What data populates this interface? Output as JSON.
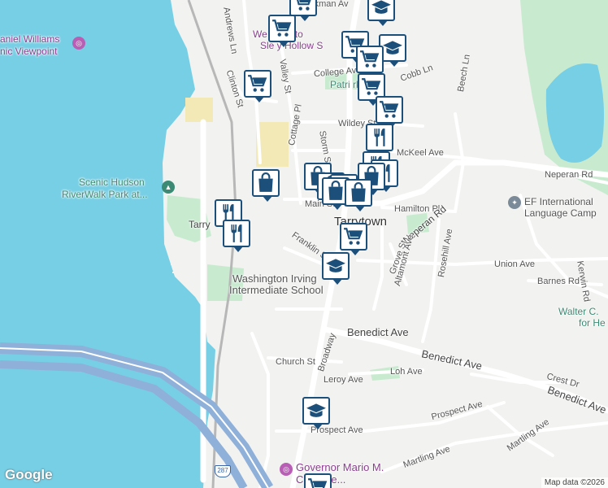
{
  "map": {
    "colors": {
      "water": "#77cfe5",
      "land": "#f2f2f0",
      "park": "#c8ebd0",
      "road": "#ffffff",
      "highway": "#8fb0d9",
      "pin_border": "#1c4f7a",
      "rail": "#b0b0b0"
    },
    "labels": {
      "beekman": "Beekman Av",
      "andrews": "Andrews Ln",
      "daniel_williams": "aniel Williams",
      "scenic_viewpoint": "nic Viewpoint",
      "welcome_historic": "We         to Histo",
      "sleepy_hollow": "Sle   y Hollow S",
      "college_ave": "College Av",
      "valley_st": "Valley St",
      "clinton_st": "Clinton St",
      "cobb_ln": "Cobb Ln",
      "patriot_park": "Patri        rk",
      "beech_ln": "Beech Ln",
      "wildey_st": "Wildey St",
      "storm_st": "Storm St",
      "mckeel_ave": "McKeel Ave",
      "neperan_rd_east": "Neperan Rd",
      "scenic_hudson": "Scenic Hudson",
      "riverwalk": "RiverWalk Park at...",
      "cottage_pl": "Cottage Pl",
      "tarry_partial": "Tarry",
      "ef_international": "EF International",
      "language_camp": "Language Camp",
      "main_st": "Main St",
      "hamilton_pl": "Hamilton Pl",
      "tarrytown": "Tarrytown",
      "neperan_rd": "Neperan Rd",
      "rosehill_ave": "Rosehill Ave",
      "franklin_st": "Franklin St",
      "grove_st": "Grove St",
      "altamont_ave": "Altamont Ave",
      "union_ave": "Union Ave",
      "kerwin_rd": "Kerwin Rd",
      "washington_irving": "Washington Irving",
      "intermediate_school": "Intermediate School",
      "barnes_rd": "Barnes Rd",
      "walter_c": "Walter C.",
      "for_he": "for He",
      "broadway": "Broadway",
      "benedict_ave_1": "Benedict Ave",
      "benedict_ave_2": "Benedict Ave",
      "benedict_ave_3": "Benedict Ave",
      "church_st": "Church St",
      "leroy_ave": "Leroy Ave",
      "loh_ave": "Loh Ave",
      "crest_dr": "Crest Dr",
      "prospect_ave": "Prospect Ave",
      "prospect_ave_2": "Prospect Ave",
      "martling_ave": "Martling Ave",
      "martling_ave_2": "Martling Ave",
      "governor_mario": "Governor Mario M.",
      "bridge": "C         Bridge...",
      "route_287": "287"
    },
    "pins": [
      {
        "name": "grocery-pin",
        "icon": "cart"
      },
      {
        "name": "school-pin",
        "icon": "school"
      },
      {
        "name": "grocery-pin",
        "icon": "cart"
      },
      {
        "name": "grocery-pin",
        "icon": "cart"
      },
      {
        "name": "school-pin",
        "icon": "school"
      },
      {
        "name": "grocery-pin",
        "icon": "cart"
      },
      {
        "name": "grocery-pin",
        "icon": "cart"
      },
      {
        "name": "grocery-pin",
        "icon": "cart"
      },
      {
        "name": "grocery-pin",
        "icon": "cart"
      },
      {
        "name": "restaurant-pin",
        "icon": "fork-knife"
      },
      {
        "name": "restaurant-pin",
        "icon": "fork-knife"
      },
      {
        "name": "shopping-pin",
        "icon": "bag"
      },
      {
        "name": "shopping-pin",
        "icon": "bag"
      },
      {
        "name": "restaurant-pin",
        "icon": "fork-knife"
      },
      {
        "name": "shopping-pin",
        "icon": "bag"
      },
      {
        "name": "shopping-pin",
        "icon": "bag"
      },
      {
        "name": "shopping-pin",
        "icon": "bag"
      },
      {
        "name": "shopping-pin",
        "icon": "bag"
      },
      {
        "name": "shopping-pin",
        "icon": "bag"
      },
      {
        "name": "restaurant-pin",
        "icon": "fork-knife"
      },
      {
        "name": "restaurant-pin",
        "icon": "fork-knife"
      },
      {
        "name": "grocery-pin",
        "icon": "cart"
      },
      {
        "name": "school-pin",
        "icon": "school"
      },
      {
        "name": "school-pin",
        "icon": "school"
      },
      {
        "name": "grocery-pin",
        "icon": "cart"
      }
    ],
    "google_logo": "Google",
    "attribution": "Map data ©2026"
  }
}
